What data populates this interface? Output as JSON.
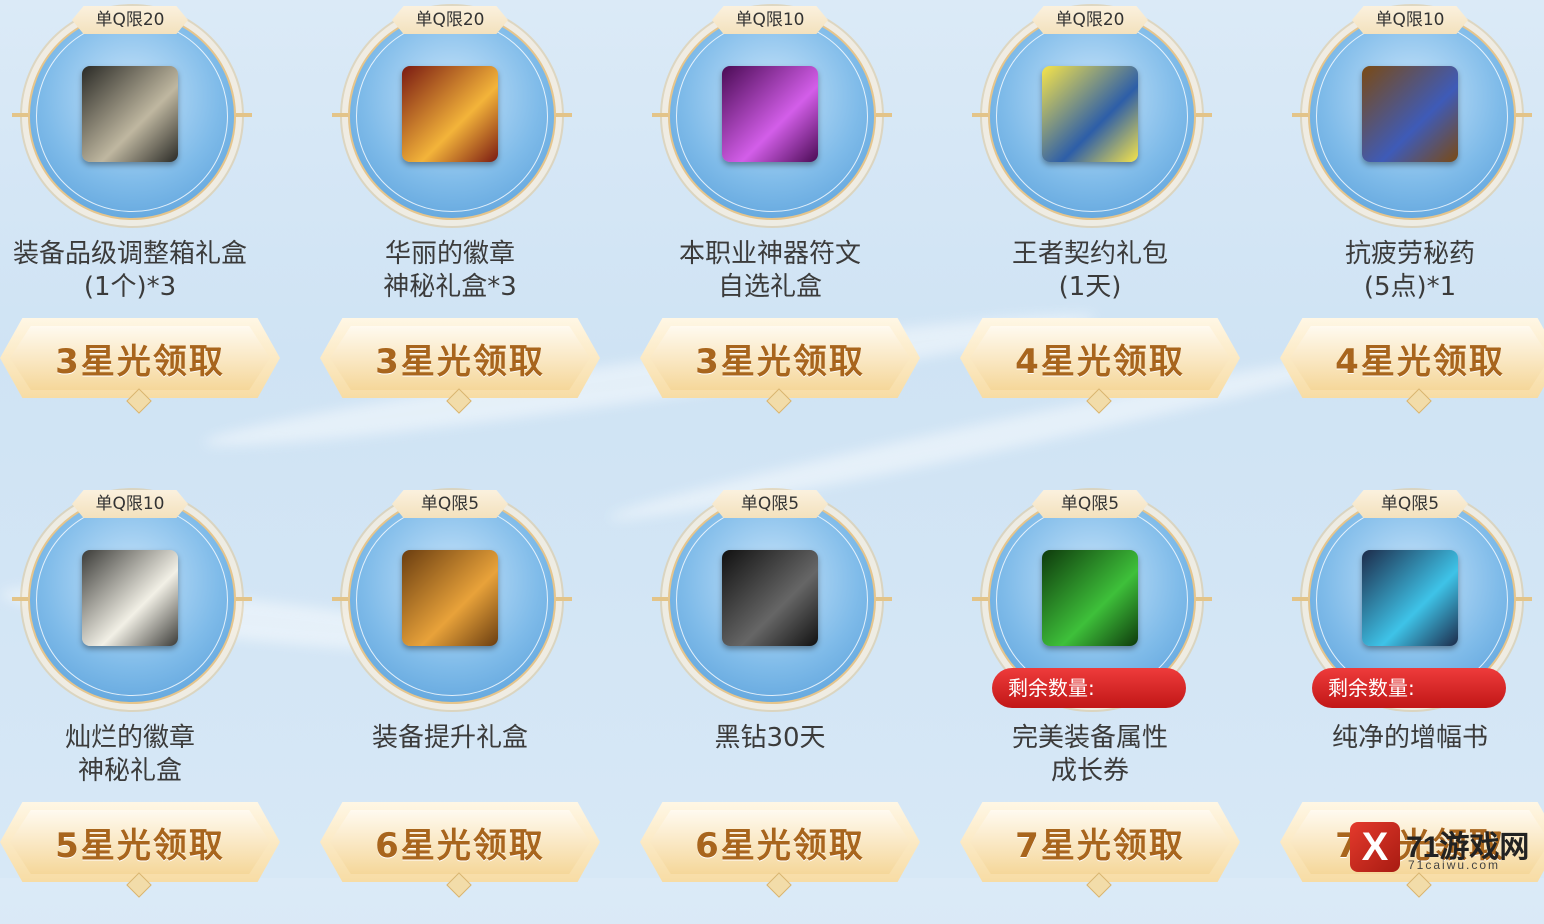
{
  "rows": [
    {
      "items": [
        {
          "limit": "单Q限20",
          "name_l1": "装备品级调整箱礼盒",
          "name_l2": "(1个)*3",
          "claim": "3星光领取",
          "icon": "dark-ornate-cube-icon",
          "colors": [
            "#2a2a26",
            "#bfb7a0"
          ]
        },
        {
          "limit": "单Q限20",
          "name_l1": "华丽的徽章",
          "name_l2": "神秘礼盒*3",
          "claim": "3星光领取",
          "icon": "golden-red-chest-icon",
          "colors": [
            "#7a1a12",
            "#f3b43a"
          ]
        },
        {
          "limit": "单Q限10",
          "name_l1": "本职业神器符文",
          "name_l2": "自选礼盒",
          "claim": "3星光领取",
          "icon": "purple-rune-box-icon",
          "colors": [
            "#4a0b54",
            "#d35ee9"
          ]
        },
        {
          "limit": "单Q限20",
          "name_l1": "王者契约礼包",
          "name_l2": "(1天)",
          "claim": "4星光领取",
          "icon": "crossed-swords-contract-icon",
          "colors": [
            "#f6e44a",
            "#2d5ea8"
          ]
        },
        {
          "limit": "单Q限10",
          "name_l1": "抗疲劳秘药",
          "name_l2": "(5点)*1",
          "claim": "4星光领取",
          "icon": "potion-bottle-icon",
          "colors": [
            "#7a4a14",
            "#3e5bb8"
          ]
        }
      ]
    },
    {
      "items": [
        {
          "limit": "单Q限10",
          "name_l1": "灿烂的徽章",
          "name_l2": "神秘礼盒",
          "claim": "5星光领取",
          "icon": "white-ornate-cube-icon",
          "colors": [
            "#3b3b38",
            "#f2f0e6"
          ]
        },
        {
          "limit": "单Q限5",
          "name_l1": "装备提升礼盒",
          "name_l2": "",
          "claim": "6星光领取",
          "icon": "golden-treasure-chest-icon",
          "colors": [
            "#6a3d10",
            "#e8a23a"
          ]
        },
        {
          "limit": "单Q限5",
          "name_l1": "黑钻30天",
          "name_l2": "",
          "claim": "6星光领取",
          "icon": "black-diamond-icon",
          "colors": [
            "#111111",
            "#666666"
          ]
        },
        {
          "limit": "单Q限5",
          "name_l1": "完美装备属性",
          "name_l2": "成长券",
          "claim": "7星光领取",
          "icon": "green-sword-upgrade-icon",
          "colors": [
            "#0e3a0c",
            "#3ec03a"
          ],
          "remain": "剩余数量:"
        },
        {
          "limit": "单Q限5",
          "name_l1": "纯净的增幅书",
          "name_l2": "",
          "claim": "7星光领取",
          "icon": "blue-crystal-stone-icon",
          "colors": [
            "#1d2b4a",
            "#3ec3e8"
          ],
          "remain": "剩余数量:"
        }
      ]
    }
  ],
  "watermark": {
    "logo_letter": "X",
    "name": "71游戏网",
    "domain": "71caiwu.com"
  }
}
